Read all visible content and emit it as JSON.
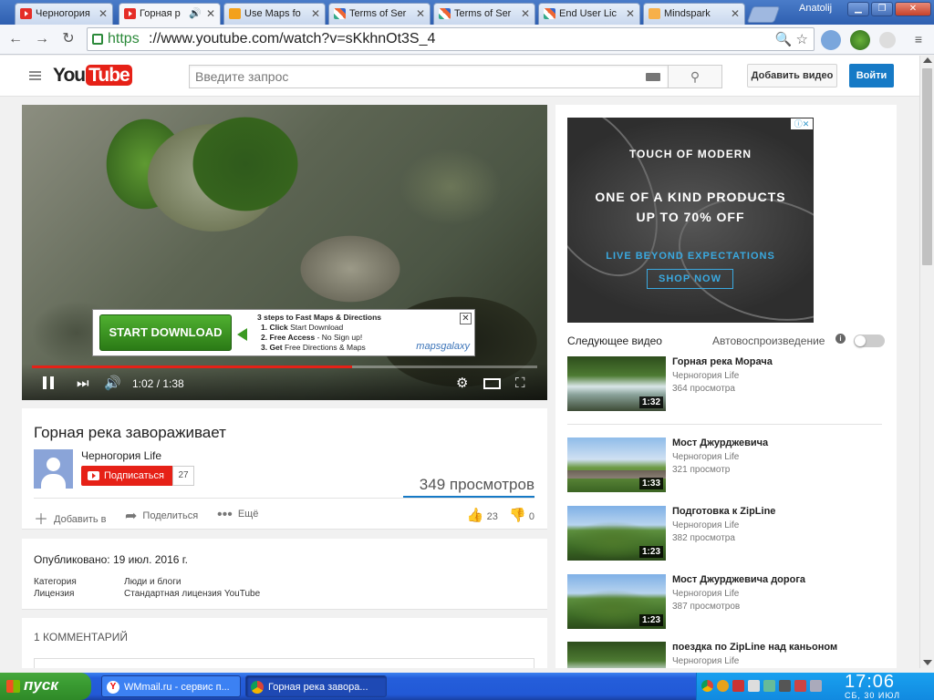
{
  "browser": {
    "tabs": [
      {
        "title": "Черногория",
        "icon": "youtube-icon"
      },
      {
        "title": "Горная р",
        "icon": "youtube-icon",
        "active": true,
        "audio": true
      },
      {
        "title": "Use Maps fo",
        "icon": "usemaps-icon"
      },
      {
        "title": "Terms of Ser",
        "icon": "mapquest-icon"
      },
      {
        "title": "Terms of Ser",
        "icon": "mapquest-icon"
      },
      {
        "title": "End User Lic",
        "icon": "mapquest-icon"
      },
      {
        "title": "Mindspark",
        "icon": "mindspark-icon"
      }
    ],
    "user": "Anatolij",
    "url_scheme": "https",
    "url_rest": "://www.youtube.com/watch?v=sKkhnOt3S_4"
  },
  "youtube": {
    "logo_you": "You",
    "logo_tube": "Tube",
    "search_placeholder": "Введите запрос",
    "upload_label": "Добавить видео",
    "signin_label": "Войти"
  },
  "player": {
    "time": "1:02 / 1:38",
    "progress_fraction": 0.633,
    "overlay_ad": {
      "button": "START DOWNLOAD",
      "heading": "3 steps to Fast Maps & Directions",
      "step1_bold": "1. Click",
      "step1_rest": " Start Download",
      "step2_bold": "2. Free Access",
      "step2_rest": " - No Sign up!",
      "step3_bold": "3. Get",
      "step3_rest": " Free Directions & Maps",
      "brand": "mapsgalaxy"
    }
  },
  "video": {
    "title": "Горная река завораживает",
    "channel": "Черногория Life",
    "subscribe_label": "Подписаться",
    "subscriber_count": "27",
    "views": "349 просмотров",
    "add_to": "Добавить в",
    "share": "Поделиться",
    "more": "Ещё",
    "likes": "23",
    "dislikes": "0"
  },
  "description": {
    "published": "Опубликовано: 19 июл. 2016 г.",
    "category_label": "Категория",
    "category_value": "Люди и блоги",
    "license_label": "Лицензия",
    "license_value": "Стандартная лицензия YouTube"
  },
  "comments": {
    "heading": "1 КОММЕНТАРИЙ"
  },
  "sidebar_ad": {
    "brand": "TOUCH OF MODERN",
    "line1": "ONE OF A KIND PRODUCTS",
    "line2": "UP TO 70% OFF",
    "tagline": "LIVE BEYOND EXPECTATIONS",
    "cta": "SHOP NOW"
  },
  "sidebar": {
    "up_next": "Следующее видео",
    "autoplay": "Автовоспроизведение",
    "videos": [
      {
        "title": "Горная река Морача",
        "channel": "Черногория Life",
        "views": "364 просмотра",
        "duration": "1:32"
      },
      {
        "title": "Мост Джурджевича",
        "channel": "Черногория Life",
        "views": "321 просмотр",
        "duration": "1:33"
      },
      {
        "title": "Подготовка к ZipLine",
        "channel": "Черногория Life",
        "views": "382 просмотра",
        "duration": "1:23"
      },
      {
        "title": "Мост Джурджевича дорога",
        "channel": "Черногория Life",
        "views": "387 просмотров",
        "duration": "1:23"
      },
      {
        "title": "поездка по ZipLine над каньоном",
        "channel": "Черногория Life",
        "views": "",
        "duration": ""
      }
    ]
  },
  "taskbar": {
    "start": "пуск",
    "tasks": [
      {
        "label": "WMmail.ru - сервис п...",
        "icon": "yandex-icon"
      },
      {
        "label": "Горная река завора...",
        "icon": "chrome-icon"
      }
    ],
    "clock": "17:06",
    "date": "СБ, 30 ИЮЛ"
  },
  "colors": {
    "youtube_red": "#e62117",
    "youtube_blue": "#167ac6",
    "xp_taskbar": "#245edb"
  }
}
